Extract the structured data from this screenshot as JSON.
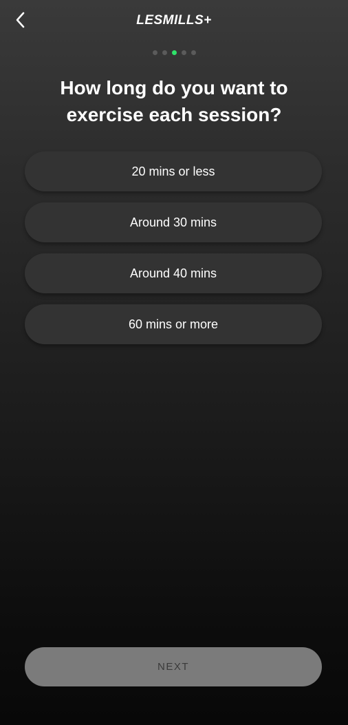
{
  "header": {
    "back_icon": "chevron-left-icon",
    "brand": "LESMILLS+"
  },
  "progress": {
    "total_steps": 5,
    "current_step": 3,
    "active_color": "#2fe26a"
  },
  "question": {
    "title": "How long do you want to exercise each session?"
  },
  "options": [
    {
      "label": "20 mins or less"
    },
    {
      "label": "Around 30 mins"
    },
    {
      "label": "Around 40 mins"
    },
    {
      "label": "60 mins or more"
    }
  ],
  "footer": {
    "next_label": "NEXT"
  }
}
